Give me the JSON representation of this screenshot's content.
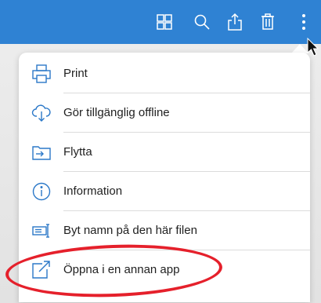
{
  "colors": {
    "toolbar_bg": "#2f82d3",
    "icon_blue": "#2b78c8",
    "highlight": "#e5202b"
  },
  "toolbar": {
    "icons": [
      "grid-icon",
      "search-icon",
      "share-icon",
      "trash-icon",
      "more-vertical-icon"
    ]
  },
  "menu": {
    "items": [
      {
        "label": "Print",
        "icon": "printer-icon"
      },
      {
        "label": "Gör tillgänglig offline",
        "icon": "cloud-download-icon"
      },
      {
        "label": "Flytta",
        "icon": "move-icon"
      },
      {
        "label": "Information",
        "icon": "info-icon"
      },
      {
        "label": "Byt namn på den här filen",
        "icon": "rename-icon"
      },
      {
        "label": "Öppna i en annan app",
        "icon": "open-in-app-icon"
      }
    ]
  }
}
